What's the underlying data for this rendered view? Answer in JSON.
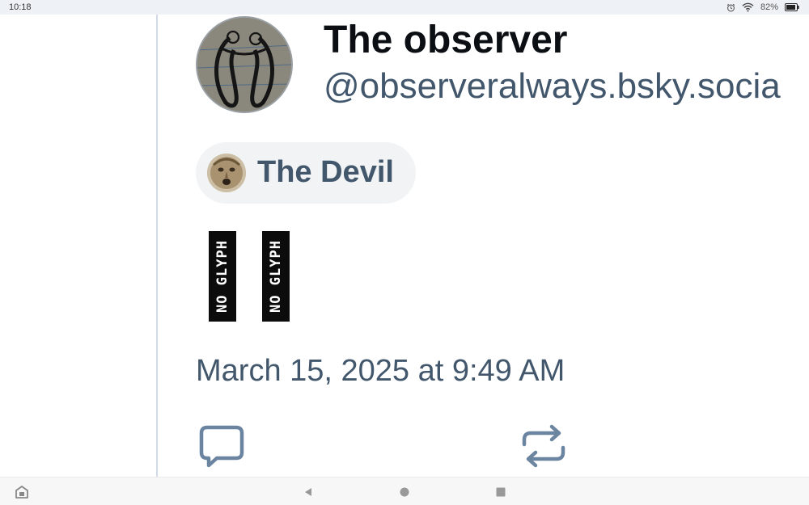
{
  "status_bar": {
    "time": "10:18",
    "battery": "82%",
    "icons": [
      "alarm-icon",
      "wifi-icon",
      "battery-icon"
    ]
  },
  "profile": {
    "display_name": "The observer",
    "handle": "@observeralways.bsky.socia"
  },
  "feed": {
    "name": "The Devil"
  },
  "post": {
    "glyphs": [
      "NO GLYPH",
      "NO GLYPH"
    ],
    "timestamp": "March 15, 2025 at 9:49 AM"
  },
  "actions": {
    "icons": [
      "reply-icon",
      "repost-icon"
    ]
  },
  "nav_bar": {
    "icons": [
      "recents-app-icon",
      "back-icon",
      "home-icon",
      "overview-icon"
    ]
  },
  "colors": {
    "accent_text": "#42576c",
    "icon": "#6b84a0",
    "divider": "#cfdbe8"
  }
}
